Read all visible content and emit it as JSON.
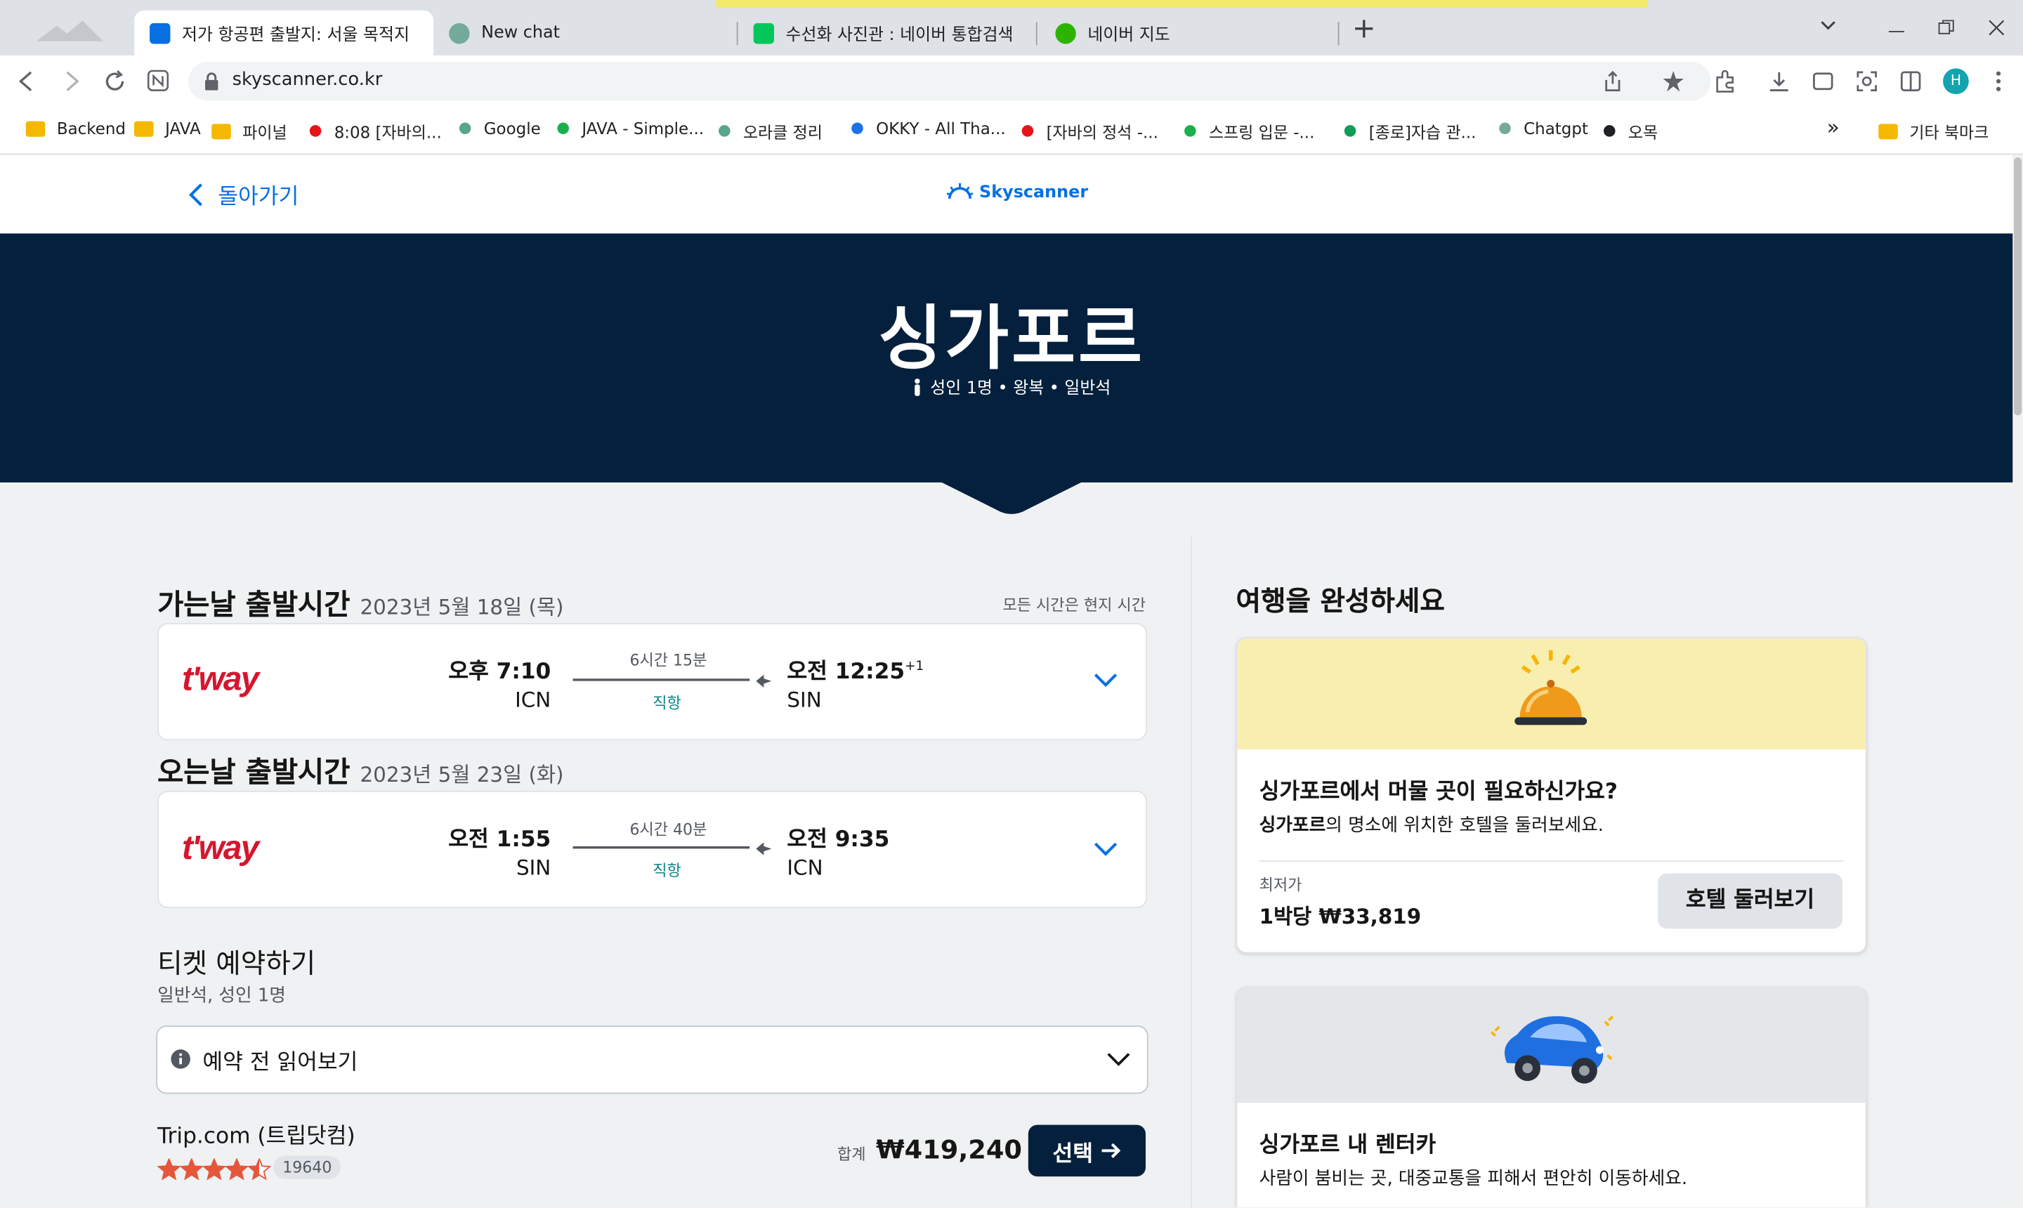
{
  "browser": {
    "tabs": [
      {
        "label": "저가 항공편 출발지: 서울 목적지",
        "favicon_color": "#0770e3",
        "active": true
      },
      {
        "label": "New chat",
        "favicon_color": "#74aa9c",
        "active": false
      },
      {
        "label": "수선화 사진관 : 네이버 통합검색",
        "favicon_color": "#03c75a",
        "active": false
      },
      {
        "label": "네이버 지도",
        "favicon_color": "#2db400",
        "active": false
      }
    ],
    "new_tab_glyph": "+",
    "url": "skyscanner.co.kr",
    "profile_initial": "H",
    "bookmarks": [
      {
        "label": "Backend",
        "icon": "folder-icon",
        "color": "#f5b800"
      },
      {
        "label": "JAVA",
        "icon": "folder-icon",
        "color": "#f5b800"
      },
      {
        "label": "파이널",
        "icon": "folder-icon",
        "color": "#f5b800"
      },
      {
        "label": "8:08 [자바의...",
        "icon": "dot",
        "color": "#e8131a"
      },
      {
        "label": "Google",
        "icon": "dot",
        "color": "#5aa58e"
      },
      {
        "label": "JAVA - Simple...",
        "icon": "dot",
        "color": "#1ab04c"
      },
      {
        "label": "오라클 정리",
        "icon": "dot",
        "color": "#5aa58e"
      },
      {
        "label": "OKKY - All Tha...",
        "icon": "dot",
        "color": "#1a73e8"
      },
      {
        "label": "[자바의 정석 -...",
        "icon": "dot",
        "color": "#e8131a"
      },
      {
        "label": "스프링 입문 -...",
        "icon": "dot",
        "color": "#1ab04c"
      },
      {
        "label": "[종로]자습 관...",
        "icon": "dot",
        "color": "#0f9d58"
      },
      {
        "label": "Chatgpt",
        "icon": "dot",
        "color": "#74aa9c"
      },
      {
        "label": "오목",
        "icon": "dot",
        "color": "#202124"
      }
    ],
    "more_bookmarks_glyph": "»",
    "other_bookmarks": "기타 북마크"
  },
  "site": {
    "back_label": "돌아가기",
    "logo_text": "Skyscanner",
    "destination": "싱가포르",
    "trip_summary": "성인 1명 • 왕복 • 일반석"
  },
  "outbound": {
    "heading": "가는날 출발시간",
    "date": "2023년 5월 18일 (목)",
    "timezone_note": "모든 시간은 현지 시간",
    "airline": "t'way",
    "depart_time": "오후 7:10",
    "depart_code": "ICN",
    "duration": "6시간 15분",
    "stops": "직항",
    "arrive_time": "오전 12:25",
    "arrive_offset": "+1",
    "arrive_code": "SIN"
  },
  "inbound": {
    "heading": "오는날 출발시간",
    "date": "2023년 5월 23일 (화)",
    "airline": "t'way",
    "depart_time": "오전 1:55",
    "depart_code": "SIN",
    "duration": "6시간 40분",
    "stops": "직항",
    "arrive_time": "오전 9:35",
    "arrive_code": "ICN"
  },
  "booking": {
    "heading": "티켓 예약하기",
    "sub": "일반석, 성인 1명",
    "read_before": "예약 전 읽어보기",
    "provider": "Trip.com (트립닷컴)",
    "rating_stars": 4.5,
    "review_count": "19640",
    "total_label": "합계",
    "price": "₩419,240",
    "select_label": "선택"
  },
  "sidebar": {
    "heading": "여행을 완성하세요",
    "hotel": {
      "title": "싱가포르에서 머물 곳이 필요하신가요?",
      "desc_bold": "싱가포르",
      "desc_rest": "의 명소에 위치한 호텔을 둘러보세요.",
      "price_label": "최저가",
      "price": "1박당 ₩33,819",
      "button": "호텔 둘러보기"
    },
    "car": {
      "title": "싱가포르 내 렌터카",
      "desc": "사람이 붐비는 곳, 대중교통을 피해서 편안히 이동하세요."
    }
  }
}
